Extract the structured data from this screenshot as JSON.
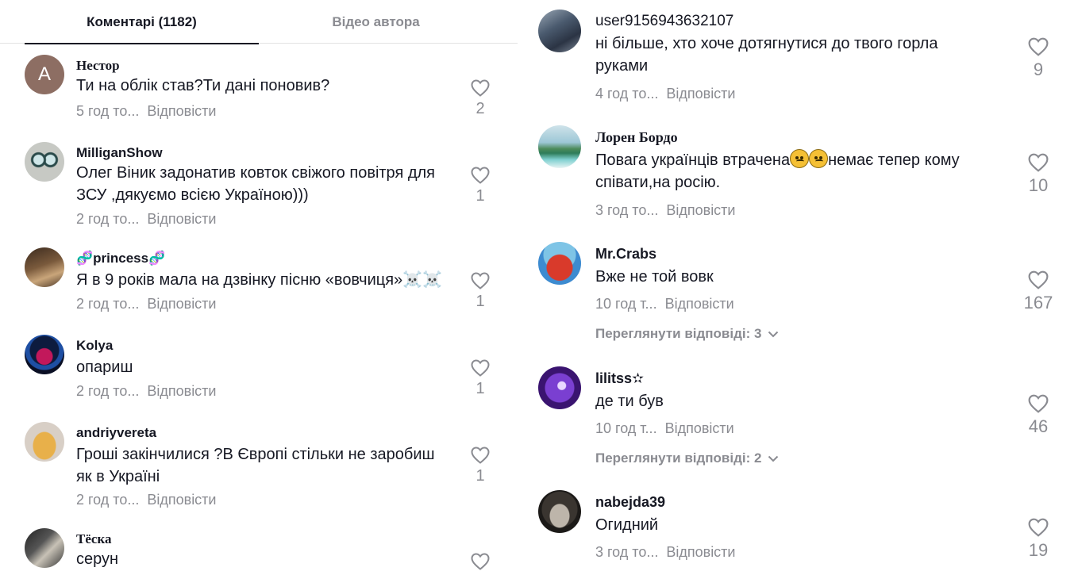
{
  "tabs": {
    "comments": "Коментарі (1182)",
    "author_videos": "Відео автора"
  },
  "reply_label": "Відповісти",
  "left_comments": [
    {
      "username": "Нестор",
      "text": "Ти на облік став?Ти дані поновив?",
      "time": "5 год то...",
      "likes": "2",
      "avatar_letter": "A",
      "avatar_color": "#8d6e63"
    },
    {
      "username": "MilliganShow",
      "text": "Олег Віник задонатив ковток свіжого повітря для ЗСУ ,дякуємо всією Україною)))",
      "time": "2 год то...",
      "likes": "1"
    },
    {
      "username": "🧬princess🧬",
      "text": "Я в 9 років мала на дзвінку пісню «вовчиця»☠️☠️",
      "time": "2 год то...",
      "likes": "1"
    },
    {
      "username": "Kolya",
      "text": "опариш",
      "time": "2 год то...",
      "likes": "1"
    },
    {
      "username": "andriyvereta",
      "text": "Гроші закінчилися ?В Європі стільки не заробиш як в Україні",
      "time": "2 год то...",
      "likes": "1"
    },
    {
      "username": "Тёска",
      "text": "серун",
      "time": "",
      "likes": ""
    }
  ],
  "right_comments": [
    {
      "username": "user9156943632107",
      "text": "ні більше, хто хоче дотягнутися до твого горла руками",
      "time": "4 год то...",
      "likes": "9"
    },
    {
      "username": "Лорен Бордо",
      "text_before": "Повага українців втрачена",
      "text_after": "немає тепер кому співати,на росію.",
      "time": "3 год то...",
      "likes": "10"
    },
    {
      "username": "Mr.Crabs",
      "text": "Вже не той вовк",
      "time": "10 год т...",
      "likes": "167",
      "replies": "Переглянути відповіді: 3"
    },
    {
      "username": "lilitss✫",
      "text": "де ти був",
      "time": "10 год т...",
      "likes": "46",
      "replies": "Переглянути відповіді: 2"
    },
    {
      "username": "nabejda39",
      "text": "Огидний",
      "time": "3 год то...",
      "likes": "19"
    }
  ]
}
